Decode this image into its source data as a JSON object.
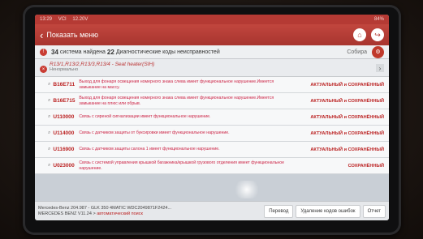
{
  "status_bar": {
    "time": "13:29",
    "vci": "VCI",
    "voltage": "12.20V",
    "battery": "84%"
  },
  "header": {
    "title": "Показать меню",
    "home_icon": "home-icon",
    "exit_icon": "exit-icon"
  },
  "summary": {
    "count_systems": "34",
    "text_systems": "система найдена",
    "count_codes": "22",
    "text_codes": "Диагностические коды неисправностей",
    "collect": "Собира"
  },
  "system": {
    "name": "R13/1,R13/2,R13/3,R13/4 - Seat heater(SIH)",
    "state": "Ненормально"
  },
  "dtc_rows": [
    {
      "code": "B16E711",
      "desc": "Выход для фонаря освещения номерного знака слева имеет функциональное нарушение.Имеется замыкание на массу.",
      "status": "АКТУАЛЬНЫЙ и СОХРАНЁННЫЙ"
    },
    {
      "code": "B16E715",
      "desc": "Выход для фонаря освещения номерного знака слева имеет функциональное нарушение.Имеется замыкание на плюс или обрыв.",
      "status": "АКТУАЛЬНЫЙ и СОХРАНЁННЫЙ"
    },
    {
      "code": "U110000",
      "desc": "Связь с сиреной сигнализации имеет функциональное нарушение.",
      "status": "АКТУАЛЬНЫЙ и СОХРАНЁННЫЙ"
    },
    {
      "code": "U114000",
      "desc": "Связь с датчиком защиты от буксировки имеет функциональное нарушение.",
      "status": "АКТУАЛЬНЫЙ и СОХРАНЁННЫЙ"
    },
    {
      "code": "U116900",
      "desc": "Связь с датчиком защиты салона 1 имеет функциональное нарушение.",
      "status": "АКТУАЛЬНЫЙ и СОХРАНЁННЫЙ"
    },
    {
      "code": "U023000",
      "desc": "Связь с системой управления крышкой багажника/крышкой грузового отделения имеет функциональное нарушение.",
      "status": "СОХРАНЁННЫЙ"
    }
  ],
  "footer": {
    "vehicle_line1": "Mercedes-Benz 204.987 - GLK 350 4MATIC  WDC2049871F2424...",
    "vehicle_line2_prefix": "MERCEDES BENZ V11.24 >",
    "vehicle_line2_mode": "автоматический поиск",
    "translate_btn": "Перевод",
    "clear_btn": "Удаление кодов ошибок",
    "report_btn": "Отчет"
  }
}
